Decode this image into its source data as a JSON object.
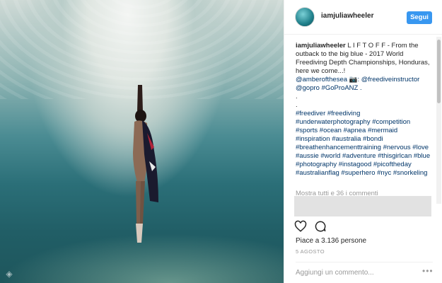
{
  "post": {
    "username": "iamjuliawheeler",
    "follow_label": "Segui",
    "caption_lines": [
      "L I F T O F F - From the outback to the big blue - 2017 World Freediving Depth Championships, Honduras, here we come...!",
      "@amberofthesea 📷: @freediveinstructor @gopro #GoProANZ ."
    ],
    "dots": [
      ".",
      "."
    ],
    "hashtags": "#freediver #freediving #underwaterphotography #competition #sports #ocean #apnea #mermaid #inspiration #australia #bondi #breathenhancementtraining #nervous #love #aussie #world #adventure #thisgirlcan #blue #photography #instagood #picoftheday #australianflag #superhero #nyc #snorkeling",
    "view_all_comments": "Mostra tutti e 36 i commenti",
    "likes": "Piace a 3.136 persone",
    "date": "5 AGOSTO",
    "comment_placeholder": "Aggiungi un commento...",
    "options_glyph": "•••"
  },
  "icons": {
    "like": "heart-outline-icon",
    "comment": "comment-bubble-icon",
    "options": "more-options-icon",
    "photo_corner": "glyph-icon"
  },
  "colors": {
    "follow_button": "#3897f0",
    "hashtag": "#003569",
    "secondary_text": "#999999"
  }
}
